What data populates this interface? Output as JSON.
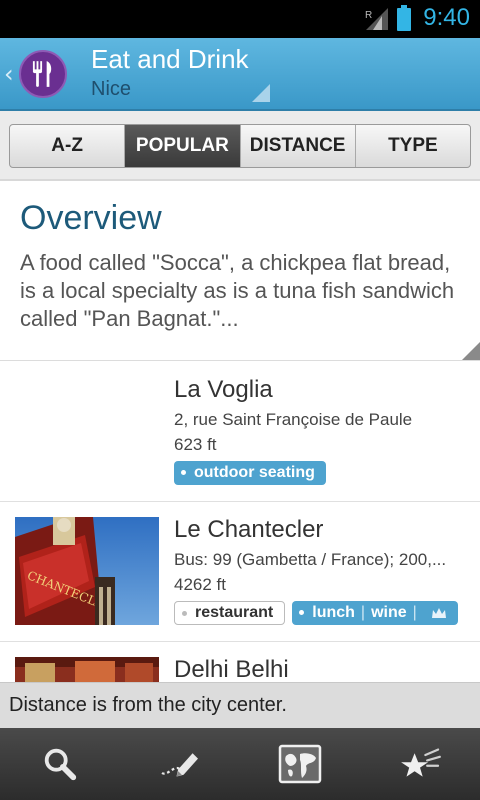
{
  "status_bar": {
    "time": "9:40",
    "roaming_indicator": "R",
    "icons": [
      "signal-icon",
      "battery-icon"
    ]
  },
  "header": {
    "title": "Eat and Drink",
    "subtitle": "Nice",
    "icon": "fork-knife-icon",
    "brand_color": "#6a2f91"
  },
  "tabs": [
    {
      "label": "A-Z",
      "active": false
    },
    {
      "label": "POPULAR",
      "active": true
    },
    {
      "label": "DISTANCE",
      "active": false
    },
    {
      "label": "TYPE",
      "active": false
    }
  ],
  "overview": {
    "heading": "Overview",
    "text": "A food called \"Socca\", a chickpea flat bread, is a local specialty as is a tuna fish sandwich called \"Pan Bagnat.\"..."
  },
  "places": [
    {
      "name": "La Voglia",
      "address": "2, rue Saint Françoise de Paule",
      "distance": "623 ft",
      "tags": [
        {
          "style": "blue",
          "parts": [
            "outdoor seating"
          ]
        }
      ]
    },
    {
      "name": "Le Chantecler",
      "address": "Bus: 99 (Gambetta / France); 200,...",
      "distance": "4262 ft",
      "tags": [
        {
          "style": "white",
          "parts": [
            "restaurant"
          ]
        },
        {
          "style": "blue",
          "parts": [
            "lunch",
            "wine"
          ],
          "icon": "crown-icon"
        }
      ]
    },
    {
      "name": "Delhi Belhi"
    }
  ],
  "notice": "Distance is from the city center.",
  "bottom_bar": [
    "search-icon",
    "edit-notes-icon",
    "map-icon",
    "favorites-icon"
  ],
  "colors": {
    "accent": "#33b5e5",
    "header": "#4aa6d4",
    "tag_blue": "#4ea3cf",
    "heading": "#1d5a7a"
  }
}
